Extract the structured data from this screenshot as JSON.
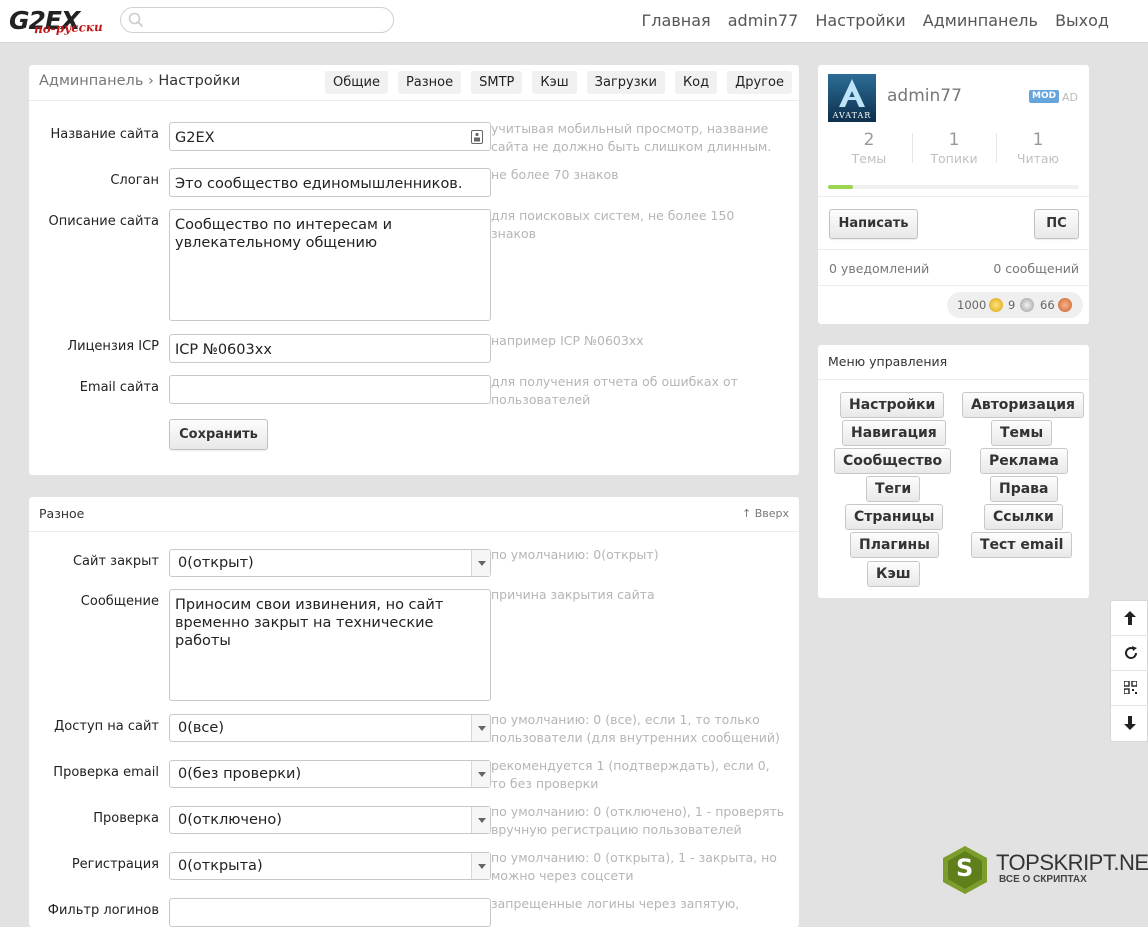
{
  "header": {
    "logo": "G2EX",
    "logo_sub": "по-русски",
    "search_placeholder": "",
    "nav": [
      "Главная",
      "admin77",
      "Настройки",
      "Админпанель",
      "Выход"
    ]
  },
  "settings": {
    "breadcrumb_parent": "Админпанель",
    "breadcrumb_sep": "›",
    "breadcrumb_current": "Настройки",
    "tabs": [
      "Общие",
      "Разное",
      "SMTP",
      "Кэш",
      "Загрузки",
      "Код",
      "Другое"
    ],
    "fields": [
      {
        "label": "Название сайта",
        "value": "G2EX",
        "hint": "учитывая мобильный просмотр, название сайта не должно быть слишком длинным."
      },
      {
        "label": "Слоган",
        "value": "Это сообщество единомышленников.",
        "hint": "не более 70 знаков"
      },
      {
        "label": "Описание сайта",
        "value": "Сообщество по интересам и увлекательному общению",
        "hint": "для поисковых систем, не более 150 знаков"
      },
      {
        "label": "Лицензия ICP",
        "value": "ICP №0603xx",
        "hint": "например ICP №0603xx"
      },
      {
        "label": "Email сайта",
        "value": "",
        "hint": "для получения отчета об ошибках от пользователей"
      }
    ],
    "save_label": "Сохранить"
  },
  "misc": {
    "title": "Разное",
    "top_link": "↑ Вверх",
    "fields": [
      {
        "label": "Сайт закрыт",
        "value": "0(открыт)",
        "hint": "по умолчанию: 0(открыт)"
      },
      {
        "label": "Сообщение",
        "value": "Приносим свои извинения, но сайт временно закрыт на технические работы",
        "hint": "причина закрытия сайта"
      },
      {
        "label": "Доступ на сайт",
        "value": "0(все)",
        "hint": "по умолчанию: 0 (все), если 1, то только пользователи (для внутренних сообщений)"
      },
      {
        "label": "Проверка email",
        "value": "0(без проверки)",
        "hint": "рекомендуется 1 (подтверждать), если 0, то без проверки"
      },
      {
        "label": "Проверка",
        "value": "0(отключено)",
        "hint": "по умолчанию: 0 (отключено), 1 - проверять вручную регистрацию пользователей"
      },
      {
        "label": "Регистрация",
        "value": "0(открыта)",
        "hint": "по умолчанию: 0 (открыта), 1 - закрыта, но можно через соцсети"
      },
      {
        "label": "Фильтр логинов",
        "value": "",
        "hint": "запрещенные логины через запятую,"
      }
    ]
  },
  "user": {
    "avatar_text": "AVATAR",
    "name": "admin77",
    "mod_badge": "MOD",
    "ad_badge": "AD",
    "stats": [
      {
        "num": "2",
        "label": "Темы"
      },
      {
        "num": "1",
        "label": "Топики"
      },
      {
        "num": "1",
        "label": "Читаю"
      }
    ],
    "progress": 0.1,
    "write_label": "Написать",
    "pm_label": "ПС",
    "notifications": "0 уведомлений",
    "messages": "0 сообщений",
    "balance": {
      "gold": "1000",
      "silver": "9",
      "bronze": "66"
    }
  },
  "admin_menu": {
    "title": "Меню управления",
    "left": [
      "Настройки",
      "Навигация",
      "Сообщество",
      "Теги",
      "Страницы",
      "Плагины",
      "Кэш"
    ],
    "right": [
      "Авторизация",
      "Темы",
      "Реклама",
      "Права",
      "Ссылки",
      "Тест email"
    ]
  },
  "watermark": {
    "brand": "TOPSKRIPT.NET",
    "tagline": "ВСЕ О СКРИПТАХ",
    "letter": "S"
  },
  "colors": {
    "accent_green": "#9bd74e",
    "mod_blue": "#66a5dc",
    "logo_red": "#c01818"
  }
}
